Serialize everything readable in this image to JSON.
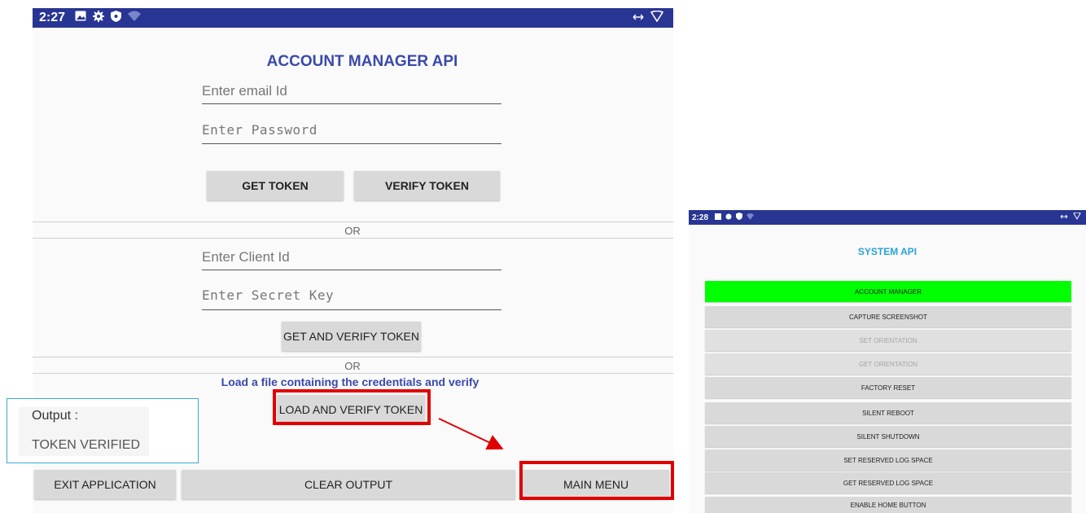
{
  "left": {
    "status": {
      "time": "2:27"
    },
    "title": "ACCOUNT MANAGER API",
    "email_placeholder": "Enter email Id",
    "password_placeholder": "Enter Password",
    "get_token": "GET TOKEN",
    "verify_token": "VERIFY TOKEN",
    "or1": "OR",
    "client_placeholder": "Enter Client Id",
    "secret_placeholder": "Enter Secret Key",
    "get_verify_token": "GET AND VERIFY TOKEN",
    "or2": "OR",
    "load_text": "Load a file containing the credentials and verify",
    "load_verify_token": "LOAD AND VERIFY TOKEN",
    "output_label": "Output :",
    "output_value": "TOKEN VERIFIED",
    "exit_app": "EXIT APPLICATION",
    "clear_output": "CLEAR OUTPUT",
    "main_menu": "MAIN MENU"
  },
  "right": {
    "status": {
      "time": "2:28"
    },
    "title": "SYSTEM API",
    "menu": [
      {
        "label": "ACCOUNT MANAGER",
        "state": "active"
      },
      {
        "label": "CAPTURE SCREENSHOT",
        "state": "enabled"
      },
      {
        "label": "SET ORIENTATION",
        "state": "disabled"
      },
      {
        "label": "GET ORIENTATION",
        "state": "disabled"
      },
      {
        "label": "FACTORY RESET",
        "state": "enabled"
      },
      {
        "label": "SILENT REBOOT",
        "state": "enabled"
      },
      {
        "label": "SILENT SHUTDOWN",
        "state": "enabled"
      },
      {
        "label": "SET RESERVED LOG SPACE",
        "state": "enabled"
      },
      {
        "label": "GET RESERVED LOG SPACE",
        "state": "enabled"
      },
      {
        "label": "ENABLE HOME BUTTON",
        "state": "enabled"
      }
    ]
  },
  "colors": {
    "statusbar": "#283593",
    "title": "#3949ab",
    "highlight": "#e10000",
    "active": "#00ff00",
    "system_title": "#29a3d6"
  },
  "icons": [
    "image-icon",
    "gear-icon",
    "shield-icon",
    "wifi-icon",
    "swap-icon",
    "signal-icon"
  ]
}
